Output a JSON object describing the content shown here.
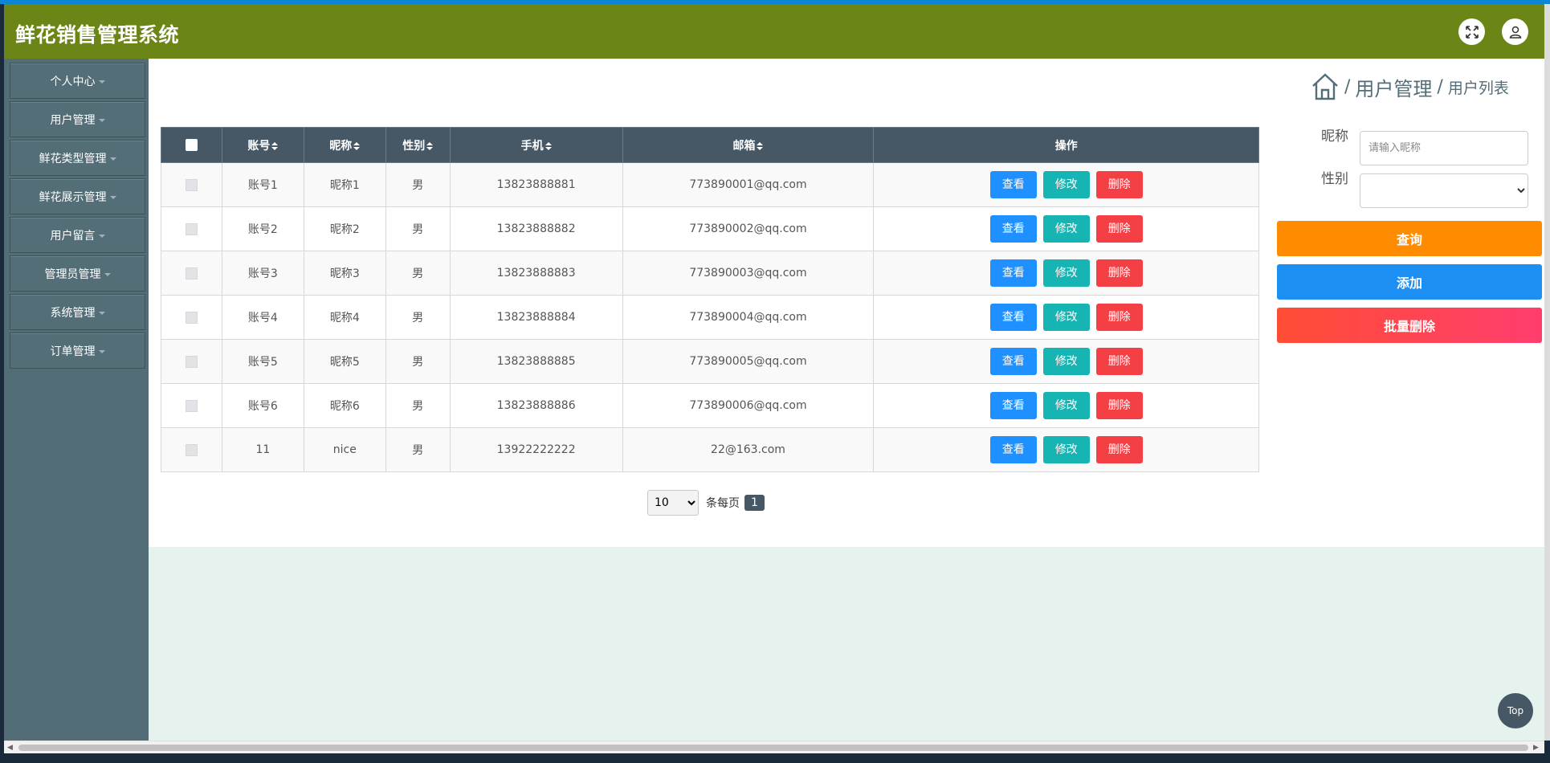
{
  "header": {
    "title": "鲜花销售管理系统",
    "expand_icon": "expand-icon",
    "user_icon": "user-icon",
    "color": "#6b8516"
  },
  "sidebar": {
    "items": [
      {
        "label": "个人中心"
      },
      {
        "label": "用户管理"
      },
      {
        "label": "鲜花类型管理"
      },
      {
        "label": "鲜花展示管理"
      },
      {
        "label": "用户留言"
      },
      {
        "label": "管理员管理"
      },
      {
        "label": "系统管理"
      },
      {
        "label": "订单管理"
      }
    ]
  },
  "breadcrumb": {
    "icon": "home-icon",
    "sep": "/",
    "level1": "用户管理",
    "level2": "用户列表"
  },
  "table": {
    "columns": [
      "账号",
      "昵称",
      "性别",
      "手机",
      "邮箱",
      "操作"
    ],
    "rows": [
      {
        "account": "账号1",
        "nickname": "昵称1",
        "gender": "男",
        "phone": "13823888881",
        "email": "773890001@qq.com"
      },
      {
        "account": "账号2",
        "nickname": "昵称2",
        "gender": "男",
        "phone": "13823888882",
        "email": "773890002@qq.com"
      },
      {
        "account": "账号3",
        "nickname": "昵称3",
        "gender": "男",
        "phone": "13823888883",
        "email": "773890003@qq.com"
      },
      {
        "account": "账号4",
        "nickname": "昵称4",
        "gender": "男",
        "phone": "13823888884",
        "email": "773890004@qq.com"
      },
      {
        "account": "账号5",
        "nickname": "昵称5",
        "gender": "男",
        "phone": "13823888885",
        "email": "773890005@qq.com"
      },
      {
        "account": "账号6",
        "nickname": "昵称6",
        "gender": "男",
        "phone": "13823888886",
        "email": "773890006@qq.com"
      },
      {
        "account": "11",
        "nickname": "nice",
        "gender": "男",
        "phone": "13922222222",
        "email": "22@163.com"
      }
    ],
    "actions": {
      "view": "查看",
      "edit": "修改",
      "delete": "删除"
    }
  },
  "pager": {
    "page_size": "10",
    "per_page_label": "条每页",
    "current_page": "1"
  },
  "search": {
    "nickname_label": "昵称",
    "nickname_placeholder": "请输入昵称",
    "gender_label": "性别",
    "gender_value": "",
    "query_button": "查询",
    "add_button": "添加",
    "batch_delete_button": "批量删除"
  },
  "scroll_top": {
    "label": "Top"
  },
  "colors": {
    "accent_header": "#6b8516",
    "sidebar": "#536d77",
    "table_header": "#465865",
    "view": "#1e90ff",
    "edit": "#16b5b3",
    "delete": "#f43f45",
    "query": "#ff8c00",
    "add": "#1e8ff2"
  }
}
